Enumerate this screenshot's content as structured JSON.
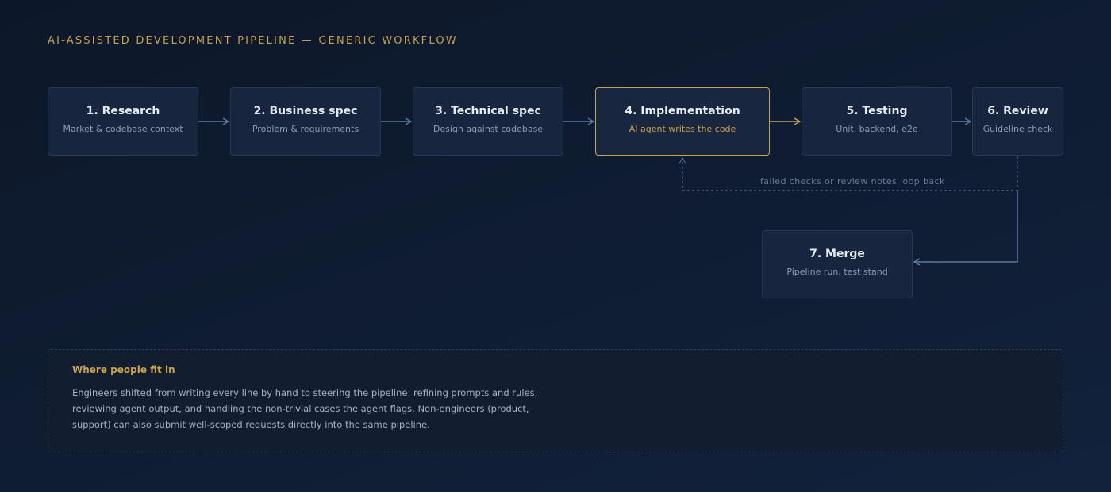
{
  "title": "AI-ASSISTED DEVELOPMENT PIPELINE — GENERIC WORKFLOW",
  "steps": [
    {
      "title": "1. Research",
      "subtitle": "Market & codebase context"
    },
    {
      "title": "2. Business spec",
      "subtitle": "Problem & requirements"
    },
    {
      "title": "3. Technical spec",
      "subtitle": "Design against codebase"
    },
    {
      "title": "4. Implementation",
      "subtitle": "AI agent writes the code",
      "highlighted": true
    },
    {
      "title": "5. Testing",
      "subtitle": "Unit, backend, e2e"
    },
    {
      "title": "6. Review",
      "subtitle": "Guideline check"
    },
    {
      "title": "7. Merge",
      "subtitle": "Pipeline run, test stand"
    }
  ],
  "loop_note": "failed checks or review notes loop back",
  "people": {
    "title": "Where people fit in",
    "body": "Engineers shifted from writing every line by hand to steering the pipeline: refining prompts and rules, reviewing agent output, and handling the non-trivial cases the agent flags. Non-engineers (product, support) can also submit well-scoped requests directly into the same pipeline."
  },
  "colors": {
    "accent": "#c9a24a",
    "connector": "#5b7aa3",
    "loop": "#4f6b91",
    "background": "#0f1d33"
  }
}
